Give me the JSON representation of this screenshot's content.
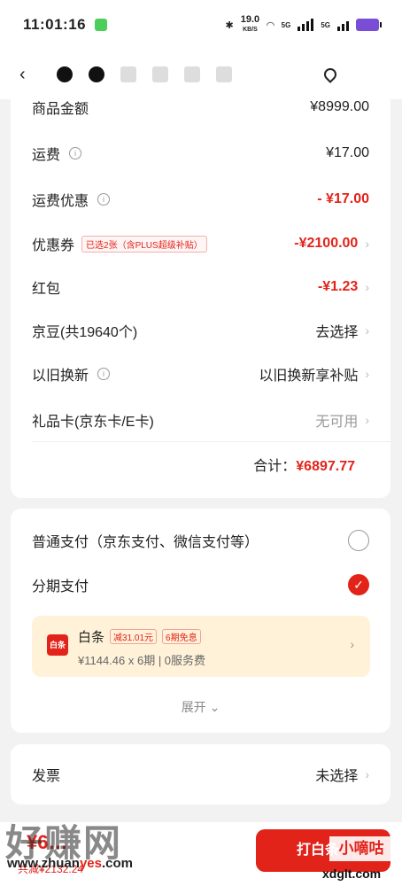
{
  "status": {
    "time": "11:01:16",
    "speed_value": "19.0",
    "speed_unit": "KB/S",
    "net1": "5G",
    "net2": "5G"
  },
  "summary": {
    "rows": [
      {
        "label": "商品金额",
        "value": "¥8999.00"
      },
      {
        "label": "运费",
        "value": "¥17.00"
      },
      {
        "label": "运费优惠",
        "value": "- ¥17.00"
      },
      {
        "label": "优惠券",
        "tag": "已选2张（含PLUS超级补贴）",
        "value": "-¥2100.00"
      },
      {
        "label": "红包",
        "value": "-¥1.23"
      },
      {
        "label": "京豆(共19640个)",
        "value": "去选择"
      },
      {
        "label": "以旧换新",
        "value": "以旧换新享补贴"
      },
      {
        "label": "礼品卡(京东卡/E卡)",
        "value": "无可用"
      }
    ],
    "total_label": "合计：",
    "total_value": "¥6897.77"
  },
  "payment": {
    "normal_label": "普通支付（京东支付、微信支付等）",
    "installment_label": "分期支付",
    "baitiao": {
      "logo": "白条",
      "title": "白条",
      "tag1": "减31.01元",
      "tag2": "6期免息",
      "desc": "¥1144.46 x 6期 | 0服务费"
    },
    "expand_label": "展开"
  },
  "invoice": {
    "label": "发票",
    "value": "未选择"
  },
  "bottom": {
    "price": "¥6…",
    "sub": "共减¥2132.24",
    "submit": "打白条"
  },
  "watermark": {
    "left_big": "好赚网",
    "left_url_a": "www.zhuan",
    "left_url_b": "yes",
    "left_url_c": ".com",
    "right_text": "小嘀咕",
    "right_url": "xdglt.com"
  },
  "colors": {
    "accent": "#e2231a",
    "background": "#f2f2f2",
    "baitiao_bg": "#fff2d9"
  }
}
